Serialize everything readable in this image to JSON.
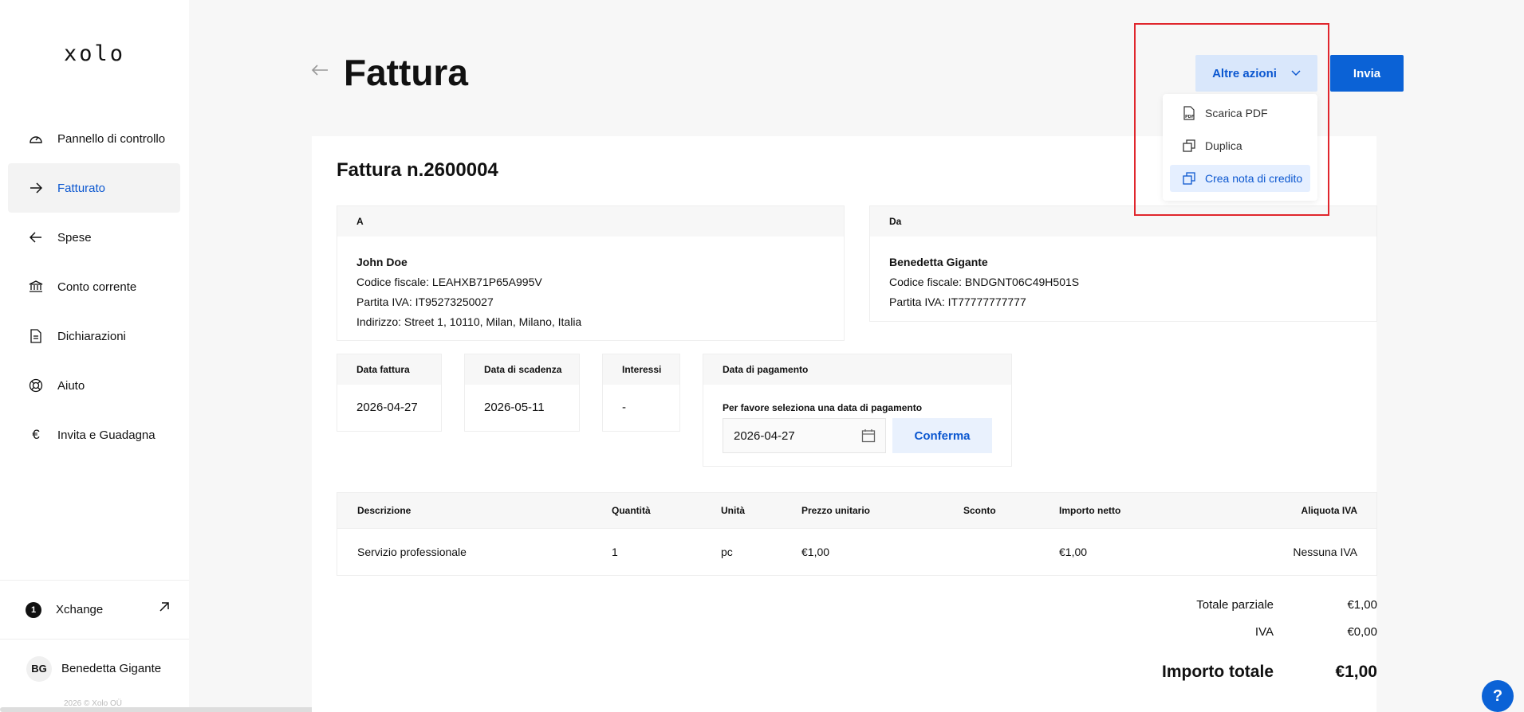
{
  "app": {
    "logo": "xolo"
  },
  "sidebar": {
    "items": [
      {
        "label": "Pannello di controllo",
        "icon": "gauge-icon"
      },
      {
        "label": "Fatturato",
        "icon": "arrow-right-icon",
        "active": true
      },
      {
        "label": "Spese",
        "icon": "arrow-left-icon"
      },
      {
        "label": "Conto corrente",
        "icon": "bank-icon"
      },
      {
        "label": "Dichiarazioni",
        "icon": "document-icon"
      },
      {
        "label": "Aiuto",
        "icon": "lifebuoy-icon"
      },
      {
        "label": "Invita e Guadagna",
        "icon": "euro-icon"
      }
    ],
    "xchange": {
      "badge": "1",
      "label": "Xchange"
    },
    "user": {
      "initials": "BG",
      "name": "Benedetta Gigante"
    },
    "copyright": "2026 © Xolo OÜ"
  },
  "header": {
    "title": "Fattura",
    "more_actions": "Altre azioni",
    "send": "Invia"
  },
  "dropdown": {
    "items": [
      {
        "label": "Scarica PDF",
        "icon": "pdf-icon"
      },
      {
        "label": "Duplica",
        "icon": "duplicate-icon"
      },
      {
        "label": "Crea nota di credito",
        "icon": "credit-note-icon"
      }
    ]
  },
  "invoice": {
    "number": "Fattura n.2600004",
    "to": {
      "heading": "A",
      "name": "John Doe",
      "tax_code": "Codice fiscale: LEAHXB71P65A995V",
      "vat": "Partita IVA: IT95273250027",
      "address": "Indirizzo: Street 1, 10110, Milan, Milano, Italia"
    },
    "from": {
      "heading": "Da",
      "name": "Benedetta Gigante",
      "tax_code": "Codice fiscale: BNDGNT06C49H501S",
      "vat": "Partita IVA: IT77777777777"
    },
    "dates": {
      "invoice_date_label": "Data fattura",
      "invoice_date": "2026-04-27",
      "due_date_label": "Data di scadenza",
      "due_date": "2026-05-11",
      "interest_label": "Interessi",
      "interest": "-",
      "payment_label": "Data di pagamento",
      "payment_prompt": "Per favore seleziona una data di pagamento",
      "payment_value": "2026-04-27",
      "confirm": "Conferma"
    },
    "table": {
      "headers": [
        "Descrizione",
        "Quantità",
        "Unità",
        "Prezzo unitario",
        "Sconto",
        "Importo netto",
        "Aliquota IVA"
      ],
      "rows": [
        [
          "Servizio professionale",
          "1",
          "pc",
          "€1,00",
          "",
          "€1,00",
          "Nessuna IVA"
        ]
      ]
    },
    "totals": {
      "subtotal_label": "Totale parziale",
      "subtotal": "€1,00",
      "vat_label": "IVA",
      "vat": "€0,00",
      "total_label": "Importo totale",
      "total": "€1,00"
    }
  },
  "help": "?",
  "colors": {
    "accent": "#0b57d0",
    "highlight": "#e0262d"
  }
}
